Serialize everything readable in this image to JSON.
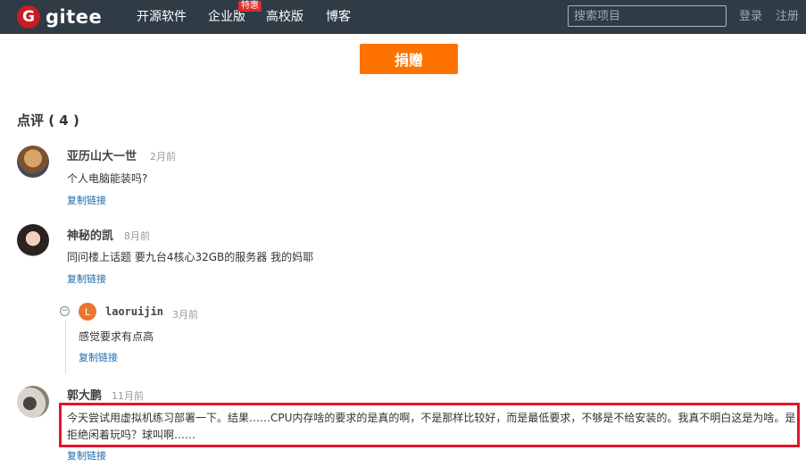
{
  "nav": {
    "logo_mark": "G",
    "logo_text": "gitee",
    "links": [
      "开源软件",
      "企业版",
      "高校版",
      "博客"
    ],
    "hot_badge": "特惠",
    "search_placeholder": "搜索项目",
    "login": "登录",
    "register": "注册"
  },
  "donate": {
    "label": "捐赠"
  },
  "comments": {
    "heading": "点评 ( 4 )",
    "items": [
      {
        "author": "亚历山大一世",
        "time": "2月前",
        "text": "个人电脑能装吗?",
        "copy": "复制链接"
      },
      {
        "author": "神秘的凯",
        "time": "8月前",
        "text": "同问楼上话题 要九台4核心32GB的服务器 我的妈耶",
        "copy": "复制链接",
        "reply": {
          "avatar_letter": "L",
          "author": "laoruijin",
          "time": "3月前",
          "text": "感觉要求有点高",
          "copy": "复制链接",
          "collapse": "−"
        }
      },
      {
        "author": "郭大鹏",
        "time": "11月前",
        "text": "今天尝试用虚拟机练习部署一下。结果……CPU内存啥的要求的是真的啊，不是那样比较好，而是最低要求，不够是不给安装的。我真不明白这是为啥。是拒绝闲着玩吗？球叫啊……",
        "copy": "复制链接"
      }
    ]
  },
  "colors": {
    "nav_bg": "#2f3b45",
    "donate": "#fe7300",
    "link": "#1e6aa8",
    "highlight": "#e3152b"
  }
}
